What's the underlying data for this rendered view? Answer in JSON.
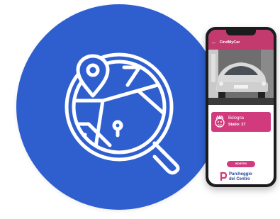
{
  "app": {
    "title": "FindMyCar"
  },
  "card": {
    "city": "Bologna",
    "stall": "Stallo: 27"
  },
  "action_button": {
    "label": "INDIETRO"
  },
  "brand": {
    "line1": "Parcheggio",
    "line2": "del Centro"
  },
  "colors": {
    "circle": "#2f5fcf",
    "accent": "#d23a7e",
    "appbar": "#c23a6e",
    "brand_text": "#1d3f9a"
  },
  "icons": [
    "map-search-icon",
    "back-arrow-icon",
    "mascot-icon",
    "parking-logo-icon"
  ]
}
